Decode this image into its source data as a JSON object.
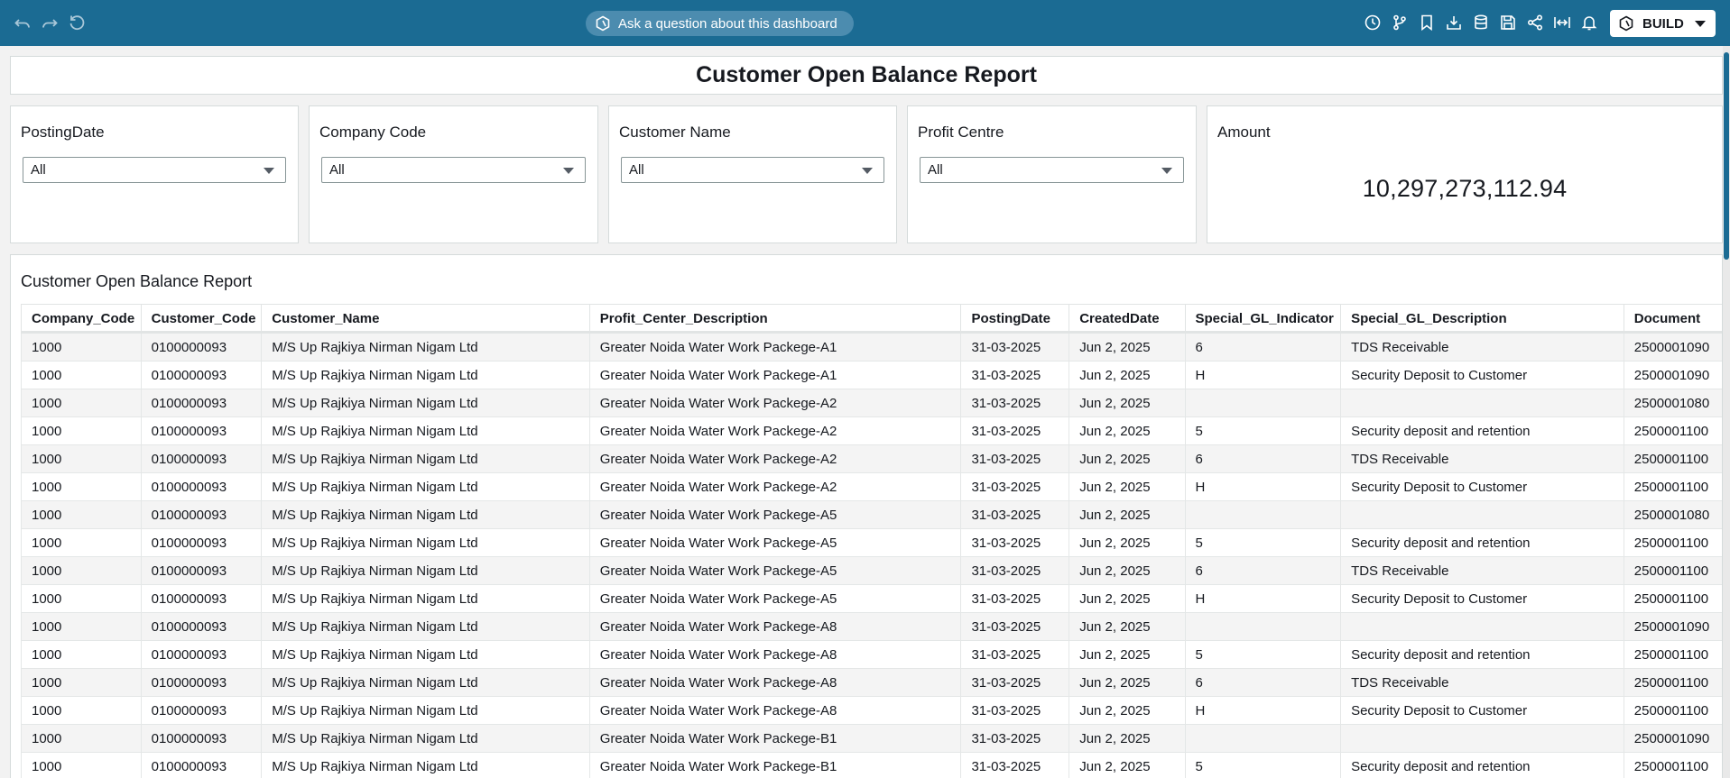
{
  "toolbar": {
    "ask_label": "Ask a question about this dashboard",
    "build_label": "BUILD"
  },
  "report_title": "Customer Open Balance Report",
  "filters": [
    {
      "label": "PostingDate",
      "value": "All"
    },
    {
      "label": "Company Code",
      "value": "All"
    },
    {
      "label": "Customer Name",
      "value": "All"
    },
    {
      "label": "Profit Centre",
      "value": "All"
    }
  ],
  "kpi": {
    "label": "Amount",
    "value": "10,297,273,112.94"
  },
  "table": {
    "title": "Customer Open Balance Report",
    "columns": [
      "Company_Code",
      "Customer_Code",
      "Customer_Name",
      "Profit_Center_Description",
      "PostingDate",
      "CreatedDate",
      "Special_GL_Indicator",
      "Special_GL_Description",
      "Document"
    ],
    "rows": [
      [
        "1000",
        "0100000093",
        "M/S Up Rajkiya Nirman Nigam Ltd",
        "Greater Noida Water Work Packege-A1",
        "31-03-2025",
        "Jun 2, 2025",
        "6",
        "TDS Receivable",
        "2500001090"
      ],
      [
        "1000",
        "0100000093",
        "M/S Up Rajkiya Nirman Nigam Ltd",
        "Greater Noida Water Work Packege-A1",
        "31-03-2025",
        "Jun 2, 2025",
        "H",
        "Security Deposit to Customer",
        "2500001090"
      ],
      [
        "1000",
        "0100000093",
        "M/S Up Rajkiya Nirman Nigam Ltd",
        "Greater Noida Water Work Packege-A2",
        "31-03-2025",
        "Jun 2, 2025",
        "",
        "",
        "2500001080"
      ],
      [
        "1000",
        "0100000093",
        "M/S Up Rajkiya Nirman Nigam Ltd",
        "Greater Noida Water Work Packege-A2",
        "31-03-2025",
        "Jun 2, 2025",
        "5",
        "Security deposit and retention",
        "2500001100"
      ],
      [
        "1000",
        "0100000093",
        "M/S Up Rajkiya Nirman Nigam Ltd",
        "Greater Noida Water Work Packege-A2",
        "31-03-2025",
        "Jun 2, 2025",
        "6",
        "TDS Receivable",
        "2500001100"
      ],
      [
        "1000",
        "0100000093",
        "M/S Up Rajkiya Nirman Nigam Ltd",
        "Greater Noida Water Work Packege-A2",
        "31-03-2025",
        "Jun 2, 2025",
        "H",
        "Security Deposit to Customer",
        "2500001100"
      ],
      [
        "1000",
        "0100000093",
        "M/S Up Rajkiya Nirman Nigam Ltd",
        "Greater Noida Water Work Packege-A5",
        "31-03-2025",
        "Jun 2, 2025",
        "",
        "",
        "2500001080"
      ],
      [
        "1000",
        "0100000093",
        "M/S Up Rajkiya Nirman Nigam Ltd",
        "Greater Noida Water Work Packege-A5",
        "31-03-2025",
        "Jun 2, 2025",
        "5",
        "Security deposit and retention",
        "2500001100"
      ],
      [
        "1000",
        "0100000093",
        "M/S Up Rajkiya Nirman Nigam Ltd",
        "Greater Noida Water Work Packege-A5",
        "31-03-2025",
        "Jun 2, 2025",
        "6",
        "TDS Receivable",
        "2500001100"
      ],
      [
        "1000",
        "0100000093",
        "M/S Up Rajkiya Nirman Nigam Ltd",
        "Greater Noida Water Work Packege-A5",
        "31-03-2025",
        "Jun 2, 2025",
        "H",
        "Security Deposit to Customer",
        "2500001100"
      ],
      [
        "1000",
        "0100000093",
        "M/S Up Rajkiya Nirman Nigam Ltd",
        "Greater Noida Water Work Packege-A8",
        "31-03-2025",
        "Jun 2, 2025",
        "",
        "",
        "2500001090"
      ],
      [
        "1000",
        "0100000093",
        "M/S Up Rajkiya Nirman Nigam Ltd",
        "Greater Noida Water Work Packege-A8",
        "31-03-2025",
        "Jun 2, 2025",
        "5",
        "Security deposit and retention",
        "2500001100"
      ],
      [
        "1000",
        "0100000093",
        "M/S Up Rajkiya Nirman Nigam Ltd",
        "Greater Noida Water Work Packege-A8",
        "31-03-2025",
        "Jun 2, 2025",
        "6",
        "TDS Receivable",
        "2500001100"
      ],
      [
        "1000",
        "0100000093",
        "M/S Up Rajkiya Nirman Nigam Ltd",
        "Greater Noida Water Work Packege-A8",
        "31-03-2025",
        "Jun 2, 2025",
        "H",
        "Security Deposit to Customer",
        "2500001100"
      ],
      [
        "1000",
        "0100000093",
        "M/S Up Rajkiya Nirman Nigam Ltd",
        "Greater Noida Water Work Packege-B1",
        "31-03-2025",
        "Jun 2, 2025",
        "",
        "",
        "2500001090"
      ],
      [
        "1000",
        "0100000093",
        "M/S Up Rajkiya Nirman Nigam Ltd",
        "Greater Noida Water Work Packege-B1",
        "31-03-2025",
        "Jun 2, 2025",
        "5",
        "Security deposit and retention",
        "2500001100"
      ]
    ]
  },
  "colors": {
    "topbar": "#1b6b93",
    "pill": "#4c8caf",
    "row_alt": "#f4f4f4"
  }
}
